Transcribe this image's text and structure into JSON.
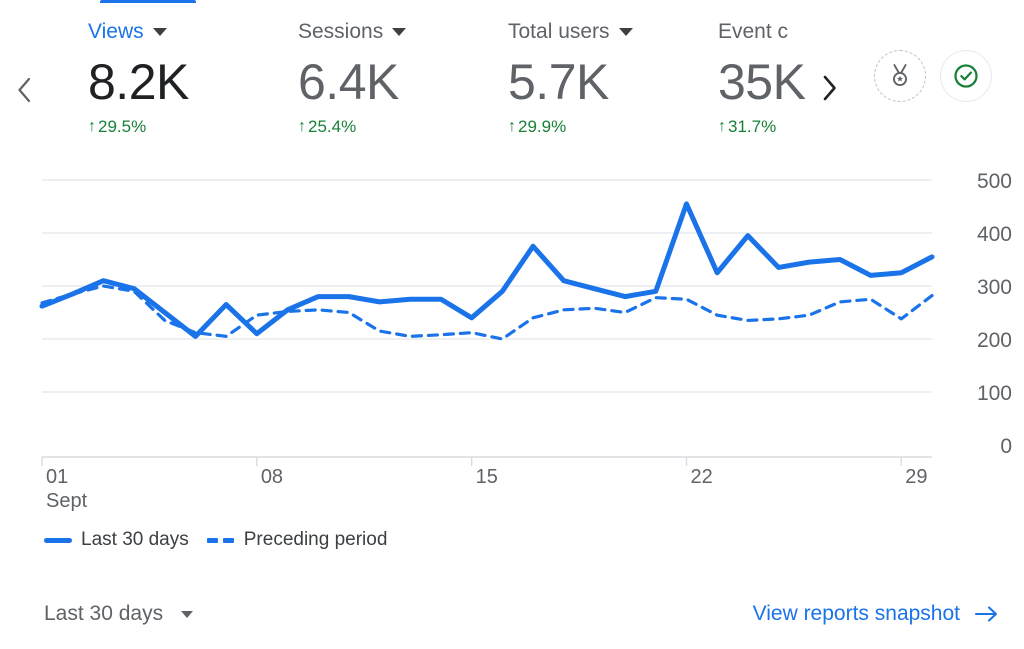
{
  "tab_indicator": {
    "active": true
  },
  "metrics_nav": {
    "prev_icon": "chevron-left-icon",
    "next_icon": "chevron-right-icon"
  },
  "metrics": [
    {
      "label": "Views",
      "value": "8.2K",
      "delta": "29.5%",
      "delta_arrow": "↑",
      "selected": true
    },
    {
      "label": "Sessions",
      "value": "6.4K",
      "delta": "25.4%",
      "delta_arrow": "↑",
      "selected": false
    },
    {
      "label": "Total users",
      "value": "5.7K",
      "delta": "29.9%",
      "delta_arrow": "↑",
      "selected": false
    },
    {
      "label": "Event c",
      "value": "35K",
      "delta": "31.7%",
      "delta_arrow": "↑",
      "selected": false
    }
  ],
  "actions": [
    {
      "name": "insights-medal-icon",
      "label": ""
    },
    {
      "name": "check-circle-icon",
      "label": ""
    }
  ],
  "legend": [
    {
      "label": "Last 30 days",
      "style": "solid"
    },
    {
      "label": "Preceding period",
      "style": "dashed"
    }
  ],
  "footer": {
    "date_range": "Last 30 days",
    "date_range_caret": "chevron-down-icon",
    "report_link": "View reports snapshot",
    "report_link_arrow": "→"
  },
  "colors": {
    "accent_blue": "#1a73e8",
    "positive_green": "#188038",
    "text_primary": "#202124",
    "text_secondary": "#5f6368",
    "gridline": "#e8eaed"
  },
  "chart_data": {
    "type": "line",
    "title": "",
    "xlabel": "",
    "ylabel": "",
    "ylim": [
      0,
      500
    ],
    "yticks": [
      0,
      100,
      200,
      300,
      400,
      500
    ],
    "ytick_labels": [
      "0",
      "100",
      "200",
      "300",
      "400",
      "500"
    ],
    "grid": true,
    "legend_position": "bottom-left",
    "x": [
      1,
      2,
      3,
      4,
      5,
      6,
      7,
      8,
      9,
      10,
      11,
      12,
      13,
      14,
      15,
      16,
      17,
      18,
      19,
      20,
      21,
      22,
      23,
      24,
      25,
      26,
      27,
      28,
      29,
      30
    ],
    "xticks": [
      1,
      8,
      15,
      22,
      29
    ],
    "xtick_labels": [
      "01",
      "08",
      "15",
      "22",
      "29"
    ],
    "xtick_sublabel": "Sept",
    "series": [
      {
        "name": "Last 30 days",
        "style": "solid",
        "color": "#1a73e8",
        "values": [
          262,
          285,
          310,
          295,
          250,
          205,
          265,
          210,
          255,
          280,
          280,
          270,
          275,
          275,
          240,
          290,
          375,
          310,
          295,
          280,
          290,
          455,
          325,
          395,
          335,
          345,
          350,
          320,
          325,
          355
        ]
      },
      {
        "name": "Preceding period",
        "style": "dashed",
        "color": "#1a73e8",
        "values": [
          268,
          285,
          300,
          290,
          235,
          212,
          205,
          245,
          252,
          255,
          250,
          215,
          205,
          208,
          212,
          200,
          240,
          255,
          258,
          250,
          278,
          275,
          245,
          235,
          238,
          245,
          270,
          275,
          238,
          282
        ]
      }
    ]
  }
}
